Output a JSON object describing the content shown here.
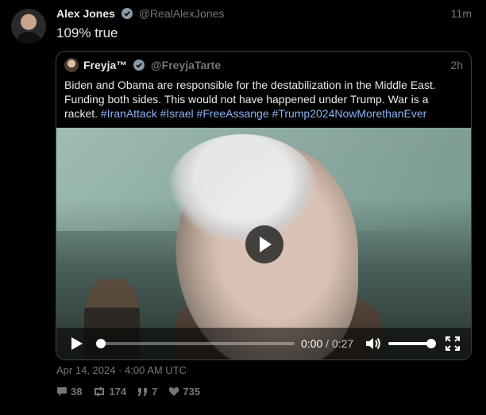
{
  "tweet": {
    "author_name": "Alex Jones",
    "author_handle": "@RealAlexJones",
    "time": "11m",
    "text": "109% true",
    "date": "Apr 14, 2024 · 4:00 AM UTC"
  },
  "quote": {
    "author_name": "Freyja™",
    "author_handle": "@FreyjaTarte",
    "time": "2h",
    "text": "Biden and Obama are responsible for the destabilization in the Middle East. Funding both sides. This would not have happened under Trump. War is a racket.",
    "hashtags": [
      "#IranAttack",
      "#Israel",
      "#FreeAssange",
      "#Trump2024NowMorethanEver"
    ]
  },
  "video": {
    "current_time": "0:00",
    "duration": "0:27",
    "progress": 0,
    "volume": 1.0
  },
  "stats": {
    "replies": "38",
    "retweets": "174",
    "quotes": "7",
    "likes": "735"
  },
  "colors": {
    "verified": "#1d9bf0",
    "hashtag": "#8ab4f8",
    "muted": "#71767b",
    "border": "#38444d"
  }
}
